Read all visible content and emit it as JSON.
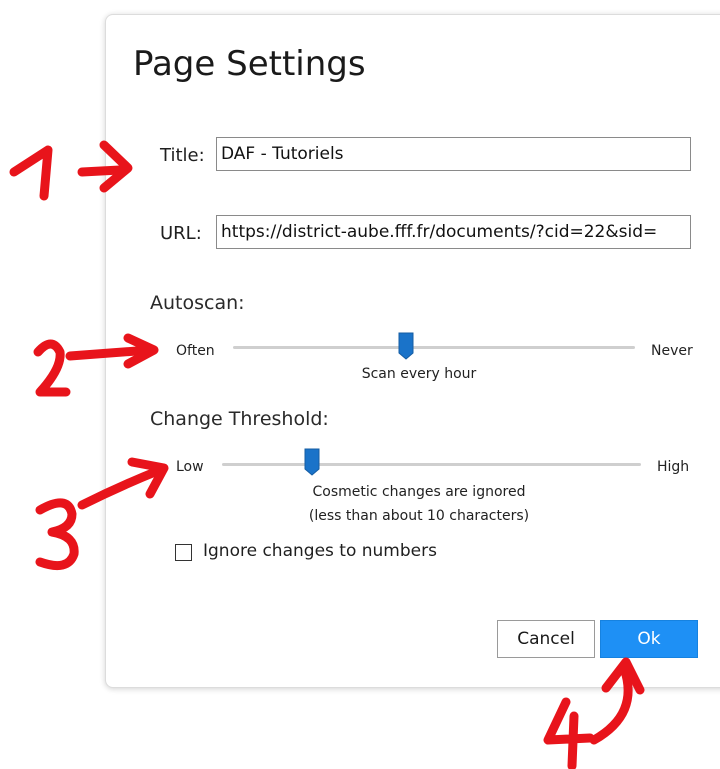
{
  "dialog": {
    "title": "Page Settings"
  },
  "title_field": {
    "label": "Title:",
    "value": "DAF - Tutoriels"
  },
  "url_field": {
    "label": "URL:",
    "value": "https://district-aube.fff.fr/documents/?cid=22&sid="
  },
  "autoscan": {
    "label": "Autoscan:",
    "min_label": "Often",
    "max_label": "Never",
    "caption": "Scan every hour",
    "level": 0.43
  },
  "threshold": {
    "label": "Change Threshold:",
    "min_label": "Low",
    "max_label": "High",
    "caption_line1": "Cosmetic changes are ignored",
    "caption_line2": "(less than about 10 characters)",
    "level": 0.2
  },
  "ignore_numbers": {
    "label": "Ignore changes to numbers",
    "checked": false
  },
  "buttons": {
    "cancel": "Cancel",
    "ok": "Ok"
  },
  "annotations": {
    "color": "#e8141b",
    "numbers": [
      "1",
      "2",
      "3",
      "4"
    ]
  },
  "colors": {
    "accent": "#1e90f5",
    "slider_thumb": "#1a73c9"
  }
}
